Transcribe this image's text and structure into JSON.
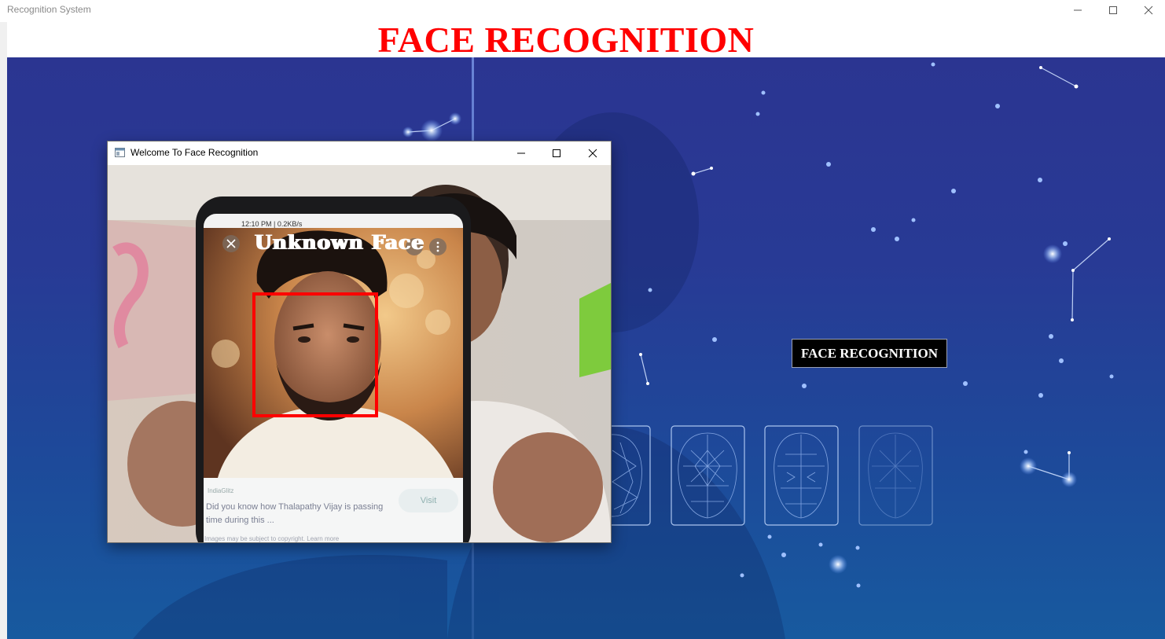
{
  "main_window": {
    "title": "Recognition System",
    "heading": "FACE RECOGNITION",
    "controls": {
      "minimize": "—",
      "maximize": "☐",
      "close": "✕"
    }
  },
  "actions": {
    "face_recognition_button": "FACE RECOGNITION"
  },
  "camera_window": {
    "title": "Welcome To Face Recognition",
    "detection_label": "Unknown Face",
    "box_color": "#ff0000"
  },
  "phone_screen": {
    "status_bar": "12:10 PM | 0.2KB/s",
    "ad_source": "IndiaGlitz",
    "ad_text": "Did you know how Thalapathy Vijay is passing time during this ...",
    "ad_button": "Visit",
    "ad_footer": "Images may be subject to copyright. Learn more"
  },
  "colors": {
    "heading": "#ff0000",
    "background": "#2b3591",
    "button_bg": "#000000",
    "button_text": "#ffffff"
  }
}
